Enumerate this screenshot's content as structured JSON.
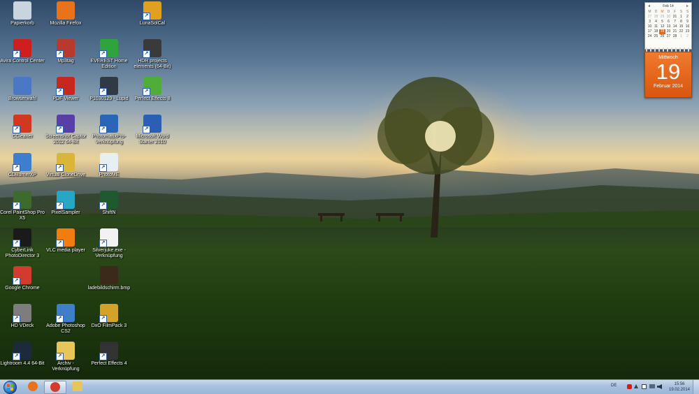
{
  "desktop": {
    "icons": [
      {
        "label": "Papierkorb",
        "icon": "recycle-bin-icon",
        "color": "#c9d4de",
        "shortcut": false
      },
      {
        "label": "Mozilla Firefox",
        "icon": "firefox-icon",
        "color": "#e8731b",
        "shortcut": false
      },
      {
        "label": "LunaSolCal",
        "icon": "lunasolcal-icon",
        "color": "#e2a020",
        "shortcut": true
      },
      {
        "label": "Avira Control Center",
        "icon": "avira-icon",
        "color": "#d21d1d",
        "shortcut": true
      },
      {
        "label": "Mp3tag",
        "icon": "mp3tag-icon",
        "color": "#b83a2e",
        "shortcut": true
      },
      {
        "label": "EVEREST Home Edition",
        "icon": "everest-icon",
        "color": "#2ea43c",
        "shortcut": true
      },
      {
        "label": "HDR projects elements (64-Bit)",
        "icon": "hdr-projects-icon",
        "color": "#3a3a3a",
        "shortcut": true
      },
      {
        "label": "Browserwahl",
        "icon": "browserwahl-icon",
        "color": "#4a78c4",
        "shortcut": false
      },
      {
        "label": "PDF Viewer",
        "icon": "pdf-viewer-icon",
        "color": "#c8271f",
        "shortcut": true
      },
      {
        "label": "P1030129 - Lupid",
        "icon": "image-file-icon",
        "color": "#2f3a45",
        "shortcut": true
      },
      {
        "label": "Perfect Effects 8",
        "icon": "perfect-effects-8-icon",
        "color": "#4fae3a",
        "shortcut": true
      },
      {
        "label": "CCleaner",
        "icon": "ccleaner-icon",
        "color": "#d2381f",
        "shortcut": true
      },
      {
        "label": "Screenshot Captor 2012 64-Bit",
        "icon": "screenshot-captor-icon",
        "color": "#5a3ea8",
        "shortcut": true
      },
      {
        "label": "PhotomatixPro-Verknüpfung",
        "icon": "photomatix-icon",
        "color": "#2a66b8",
        "shortcut": true
      },
      {
        "label": "Microsoft Word Starter 2010",
        "icon": "word-icon",
        "color": "#2b5fb4",
        "shortcut": true
      },
      {
        "label": "CDBurnerXP",
        "icon": "cdburnerxp-icon",
        "color": "#3c7fd0",
        "shortcut": true
      },
      {
        "label": "Virtual CloneDrive",
        "icon": "clonedrive-icon",
        "color": "#d9b63a",
        "shortcut": true
      },
      {
        "label": "PhotoME",
        "icon": "photome-icon",
        "color": "#e9eef2",
        "shortcut": true
      },
      {
        "label": "Corel PaintShop Pro X5",
        "icon": "paintshop-icon",
        "color": "#3d6b2c",
        "shortcut": true
      },
      {
        "label": "PixelSampler",
        "icon": "pixelsampler-icon",
        "color": "#27a6c6",
        "shortcut": true
      },
      {
        "label": "ShiftN",
        "icon": "shiftn-icon",
        "color": "#1f5a2f",
        "shortcut": true
      },
      {
        "label": "CyberLink PhotoDirector 3",
        "icon": "photodirector-icon",
        "color": "#1a1a1a",
        "shortcut": true
      },
      {
        "label": "VLC media player",
        "icon": "vlc-icon",
        "color": "#f07d10",
        "shortcut": true
      },
      {
        "label": "Silverjuke.exe - Verknüpfung",
        "icon": "silverjuke-icon",
        "color": "#f2f2f2",
        "shortcut": true
      },
      {
        "label": "Google Chrome",
        "icon": "chrome-icon",
        "color": "#d23b2e",
        "shortcut": true
      },
      {
        "label": "ladebildschirm.bmp",
        "icon": "bitmap-file-icon",
        "color": "#3b2a1a",
        "shortcut": false
      },
      {
        "label": "HD VDeck",
        "icon": "hd-vdeck-icon",
        "color": "#7d7d7d",
        "shortcut": true
      },
      {
        "label": "Adobe Photoshop CS2",
        "icon": "photoshop-icon",
        "color": "#3f7fc7",
        "shortcut": true
      },
      {
        "label": "DxO FilmPack 3",
        "icon": "dxo-filmpack-icon",
        "color": "#d4a228",
        "shortcut": true
      },
      {
        "label": "Lightroom 4.4 64-Bit",
        "icon": "lightroom-icon",
        "color": "#1c2a3c",
        "shortcut": true
      },
      {
        "label": "Archiv - Verknüpfung",
        "icon": "folder-icon",
        "color": "#e8c55a",
        "shortcut": true
      },
      {
        "label": "Perfect Effects 4",
        "icon": "perfect-effects-4-icon",
        "color": "#333333",
        "shortcut": true
      }
    ]
  },
  "calendar_gadget": {
    "month_label": "Feb 14",
    "weekday_headers": [
      "M",
      "D",
      "M",
      "D",
      "F",
      "S",
      "S"
    ],
    "days": [
      "27",
      "28",
      "29",
      "30",
      "31",
      "1",
      "2",
      "3",
      "4",
      "5",
      "6",
      "7",
      "8",
      "9",
      "10",
      "11",
      "12",
      "13",
      "14",
      "15",
      "16",
      "17",
      "18",
      "19",
      "20",
      "21",
      "22",
      "23",
      "24",
      "25",
      "26",
      "27",
      "28",
      "1",
      "2"
    ],
    "selected_day": "19",
    "day_card": {
      "weekday": "Mittwoch",
      "day": "19",
      "month": "Februar 2014"
    },
    "accent_color": "#e3681d"
  },
  "taskbar": {
    "buttons": [
      {
        "icon": "firefox-icon",
        "color": "#e8731b",
        "active": false
      },
      {
        "icon": "chrome-icon",
        "color": "#d23b2e",
        "active": true
      },
      {
        "icon": "explorer-folder-icon",
        "color": "#e8c55a",
        "active": false
      }
    ],
    "language": "DE",
    "tray_icons": [
      "avira-tray-icon",
      "arrow-tray-icon",
      "flag-icon",
      "network-icon",
      "volume-icon"
    ],
    "time": "15:56",
    "date": "19.02.2014"
  }
}
